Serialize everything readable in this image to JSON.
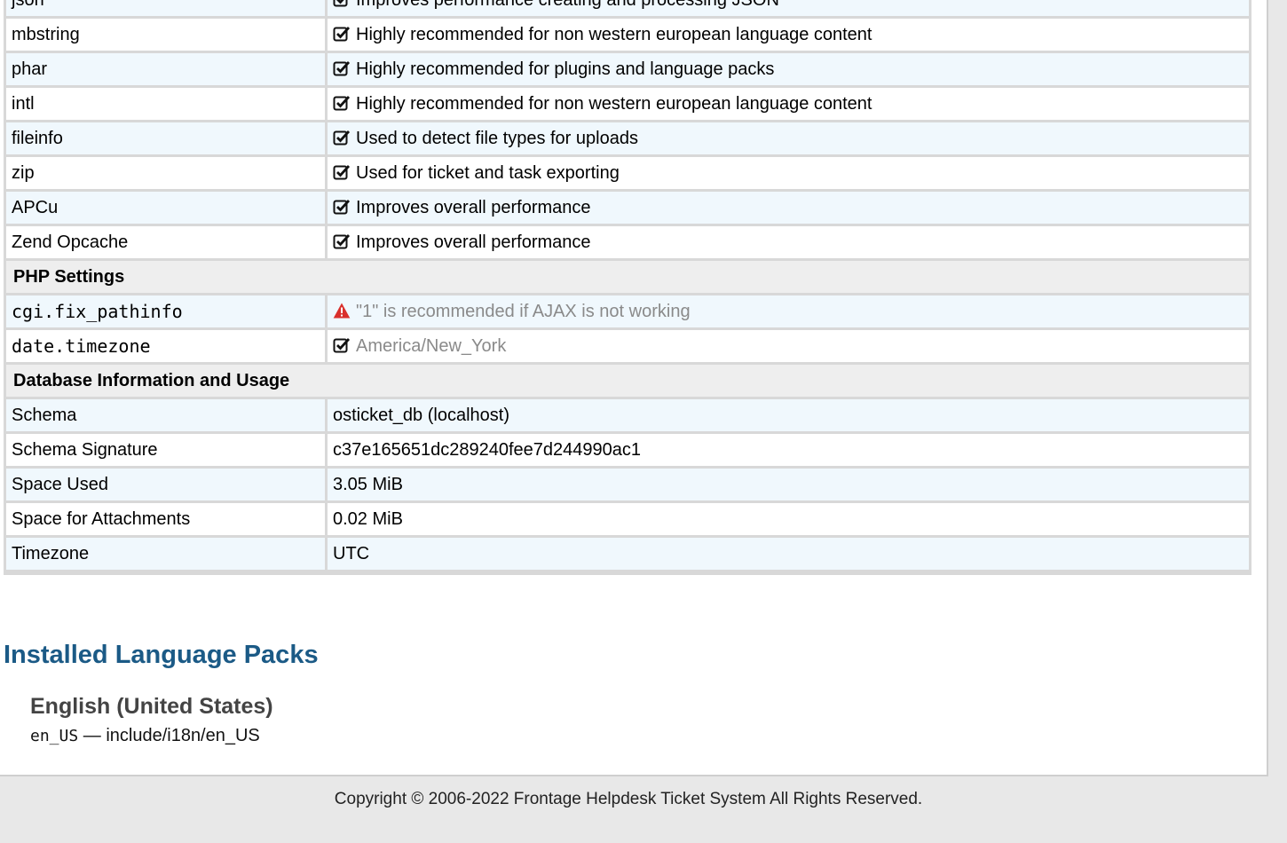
{
  "extensions": [
    {
      "name": "json",
      "desc": "Improves performance creating and processing JSON"
    },
    {
      "name": "mbstring",
      "desc": "Highly recommended for non western european language content"
    },
    {
      "name": "phar",
      "desc": "Highly recommended for plugins and language packs"
    },
    {
      "name": "intl",
      "desc": "Highly recommended for non western european language content"
    },
    {
      "name": "fileinfo",
      "desc": "Used to detect file types for uploads"
    },
    {
      "name": "zip",
      "desc": "Used for ticket and task exporting"
    },
    {
      "name": "APCu",
      "desc": "Improves overall performance"
    },
    {
      "name": "Zend Opcache",
      "desc": "Improves overall performance"
    }
  ],
  "php_settings": {
    "heading": "PHP Settings",
    "rows": [
      {
        "name": "cgi.fix_pathinfo",
        "status": "warning",
        "value": "\"1\" is recommended if AJAX is not working"
      },
      {
        "name": "date.timezone",
        "status": "ok",
        "value": "America/New_York"
      }
    ]
  },
  "database": {
    "heading": "Database Information and Usage",
    "rows": [
      {
        "name": "Schema",
        "value": "osticket_db (localhost)"
      },
      {
        "name": "Schema Signature",
        "value": "c37e165651dc289240fee7d244990ac1"
      },
      {
        "name": "Space Used",
        "value": "3.05 MiB"
      },
      {
        "name": "Space for Attachments",
        "value": "0.02 MiB"
      },
      {
        "name": "Timezone",
        "value": "UTC"
      }
    ]
  },
  "language_packs": {
    "title": "Installed Language Packs",
    "packs": [
      {
        "name": "English (United States)",
        "code": "en_US",
        "separator": "—",
        "path": "include/i18n/en_US"
      }
    ]
  },
  "footer": {
    "copyright": "Copyright © 2006-2022 Frontage Helpdesk Ticket System All Rights Reserved."
  },
  "colors": {
    "link_heading": "#1b5a86",
    "row_alt": "#f0f8fd",
    "warning": "#d9302c"
  },
  "icons": {
    "ok": "check-square-icon",
    "warning": "warning-triangle-icon"
  }
}
